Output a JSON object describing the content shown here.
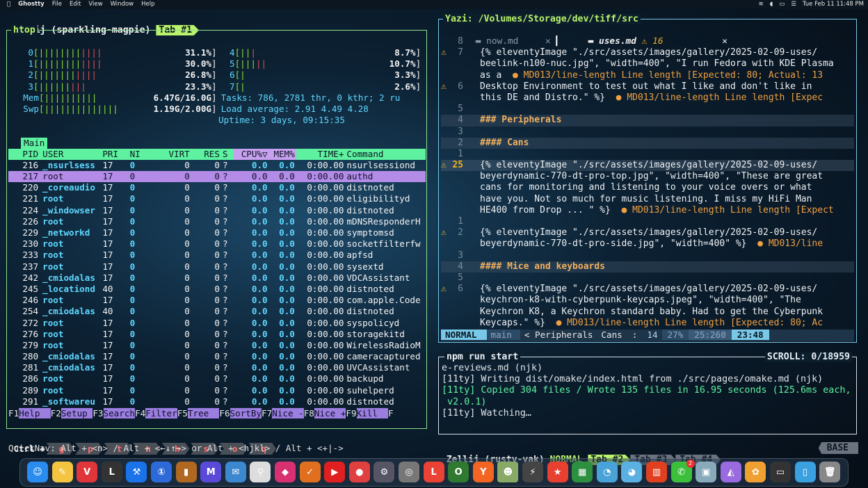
{
  "menubar": {
    "app": "Ghostty",
    "items": [
      "File",
      "Edit",
      "View",
      "Window",
      "Help"
    ],
    "clock": "Tue Feb 11  11:48 PM"
  },
  "zellij_top": {
    "session": "Zellij (sparkling-magpie)",
    "tab": "Tab #1"
  },
  "htop": {
    "title": "htop",
    "cpus_left": [
      {
        "n": "0",
        "pct": "31.1%"
      },
      {
        "n": "1",
        "pct": "30.0%"
      },
      {
        "n": "2",
        "pct": "26.8%"
      },
      {
        "n": "3",
        "pct": "23.3%"
      }
    ],
    "cpus_right": [
      {
        "n": "4",
        "pct": "8.7%"
      },
      {
        "n": "5",
        "pct": "10.7%"
      },
      {
        "n": "6",
        "pct": "3.3%"
      },
      {
        "n": "7",
        "pct": "2.6%"
      }
    ],
    "mem": "6.47G/16.0G",
    "swp": "1.19G/2.00G",
    "tasks": "Tasks: 786, 2781 thr, 0 kthr; 2 ru",
    "load": "Load average: 2.91 4.49 4.28",
    "uptime": "Uptime: 3 days, 09:15:35",
    "tab": "Main",
    "columns": [
      "PID",
      "USER",
      "PRI",
      "NI",
      "VIRT",
      "RES",
      "S",
      "CPU%▽",
      "MEM%",
      "TIME+",
      "Command"
    ],
    "procs": [
      [
        "216",
        "_nsurlsess",
        "17",
        "0",
        "0",
        "0",
        "?",
        "0.0",
        "0.0",
        "0:00.00",
        "nsurlsessiond"
      ],
      [
        "217",
        "root",
        "17",
        "0",
        "0",
        "0",
        "?",
        "0.0",
        "0.0",
        "0:00.00",
        "authd"
      ],
      [
        "220",
        "_coreaudio",
        "17",
        "0",
        "0",
        "0",
        "?",
        "0.0",
        "0.0",
        "0:00.00",
        "distnoted"
      ],
      [
        "221",
        "root",
        "17",
        "0",
        "0",
        "0",
        "?",
        "0.0",
        "0.0",
        "0:00.00",
        "eligibilityd"
      ],
      [
        "224",
        "_windowser",
        "17",
        "0",
        "0",
        "0",
        "?",
        "0.0",
        "0.0",
        "0:00.00",
        "distnoted"
      ],
      [
        "226",
        "root",
        "17",
        "0",
        "0",
        "0",
        "?",
        "0.0",
        "0.0",
        "0:00.00",
        "mDNSResponderH"
      ],
      [
        "229",
        "_networkd",
        "17",
        "0",
        "0",
        "0",
        "?",
        "0.0",
        "0.0",
        "0:00.00",
        "symptomsd"
      ],
      [
        "230",
        "root",
        "17",
        "0",
        "0",
        "0",
        "?",
        "0.0",
        "0.0",
        "0:00.00",
        "socketfilterfw"
      ],
      [
        "233",
        "root",
        "17",
        "0",
        "0",
        "0",
        "?",
        "0.0",
        "0.0",
        "0:00.00",
        "apfsd"
      ],
      [
        "237",
        "root",
        "17",
        "0",
        "0",
        "0",
        "?",
        "0.0",
        "0.0",
        "0:00.00",
        "sysextd"
      ],
      [
        "242",
        "_cmiodalas",
        "17",
        "0",
        "0",
        "0",
        "?",
        "0.0",
        "0.0",
        "0:00.00",
        "VDCAssistant"
      ],
      [
        "245",
        "_locationd",
        "40",
        "0",
        "0",
        "0",
        "?",
        "0.0",
        "0.0",
        "0:00.00",
        "distnoted"
      ],
      [
        "246",
        "root",
        "17",
        "0",
        "0",
        "0",
        "?",
        "0.0",
        "0.0",
        "0:00.00",
        "com.apple.Code"
      ],
      [
        "254",
        "_cmiodalas",
        "40",
        "0",
        "0",
        "0",
        "?",
        "0.0",
        "0.0",
        "0:00.00",
        "distnoted"
      ],
      [
        "272",
        "root",
        "17",
        "0",
        "0",
        "0",
        "?",
        "0.0",
        "0.0",
        "0:00.00",
        "syspolicyd"
      ],
      [
        "276",
        "root",
        "17",
        "0",
        "0",
        "0",
        "?",
        "0.0",
        "0.0",
        "0:00.00",
        "storagekitd"
      ],
      [
        "279",
        "root",
        "17",
        "0",
        "0",
        "0",
        "?",
        "0.0",
        "0.0",
        "0:00.00",
        "WirelessRadioM"
      ],
      [
        "280",
        "_cmiodalas",
        "17",
        "0",
        "0",
        "0",
        "?",
        "0.0",
        "0.0",
        "0:00.00",
        "cameracaptured"
      ],
      [
        "281",
        "_cmiodalas",
        "17",
        "0",
        "0",
        "0",
        "?",
        "0.0",
        "0.0",
        "0:00.00",
        "UVCAssistant"
      ],
      [
        "286",
        "root",
        "17",
        "0",
        "0",
        "0",
        "?",
        "0.0",
        "0.0",
        "0:00.00",
        "backupd"
      ],
      [
        "289",
        "root",
        "17",
        "0",
        "0",
        "0",
        "?",
        "0.0",
        "0.0",
        "0:00.00",
        "suhelperd"
      ],
      [
        "291",
        "_softwareu",
        "17",
        "0",
        "0",
        "0",
        "?",
        "0.0",
        "0.0",
        "0:00.00",
        "distnoted"
      ]
    ],
    "fkeys": [
      {
        "k": "F1",
        "v": "Help  "
      },
      {
        "k": "F2",
        "v": "Setup "
      },
      {
        "k": "F3",
        "v": "Search"
      },
      {
        "k": "F4",
        "v": "Filter"
      },
      {
        "k": "F5",
        "v": "Tree  "
      },
      {
        "k": "F6",
        "v": "SortBy"
      },
      {
        "k": "F7",
        "v": "Nice -"
      },
      {
        "k": "F8",
        "v": "Nice +"
      },
      {
        "k": "F9",
        "v": "Kill  "
      },
      {
        "k": "F",
        "v": ""
      }
    ]
  },
  "zellij_hints": {
    "ctrl": "Ctrl +",
    "keys": [
      "g",
      "p",
      "t",
      "n",
      "h",
      "s",
      "o",
      "q"
    ],
    "quicknav": "QuickNav: Alt + <n> / Alt + <←↓↑→> or Alt + <hjkl> / Alt + <+|->"
  },
  "editor": {
    "title": "Yazi: /Volumes/Storage/dev/tiff/src",
    "tab1": "now.md",
    "tab2": "uses.md",
    "warn_count": "16",
    "lines": [
      {
        "n": "8",
        "w": false,
        "t": "",
        "d": ""
      },
      {
        "n": "7",
        "w": true,
        "t": "{% eleventyImage \"./src/assets/images/gallery/2025-02-09-uses/",
        "d": ""
      },
      {
        "n": "",
        "w": false,
        "t": "beelink-n100-nuc.jpg\", \"width=400\", \"I run Fedora with KDE Plasma",
        "d": ""
      },
      {
        "n": "",
        "w": false,
        "t": "as a",
        "d": "  ● MD013/line-length Line length [Expected: 80; Actual: 13"
      },
      {
        "n": "6",
        "w": true,
        "t": "Desktop Environment to test out what I like and don't like in",
        "d": ""
      },
      {
        "n": "",
        "w": false,
        "t": "this DE and Distro.\" %}",
        "d": "  ● MD013/line-length Line length [Expec"
      },
      {
        "n": "5",
        "w": false,
        "t": "",
        "d": ""
      },
      {
        "n": "4",
        "w": false,
        "t": "### Peripherals",
        "d": "",
        "h": true
      },
      {
        "n": "3",
        "w": false,
        "t": "",
        "d": ""
      },
      {
        "n": "2",
        "w": false,
        "t": "#### Cans",
        "d": "",
        "h": true
      },
      {
        "n": "1",
        "w": false,
        "t": "",
        "d": ""
      },
      {
        "n": "25",
        "w": true,
        "cur": true,
        "t": "{% eleventyImage \"./src/assets/images/gallery/2025-02-09-uses/",
        "d": ""
      },
      {
        "n": "",
        "w": false,
        "t": "beyerdynamic-770-dt-pro-top.jpg\", \"width=400\", \"These are great",
        "d": ""
      },
      {
        "n": "",
        "w": false,
        "t": "cans for monitoring and listening to your voice overs or what",
        "d": ""
      },
      {
        "n": "",
        "w": false,
        "t": "have you. Not so much for music listening. I miss my HiFi Man",
        "d": ""
      },
      {
        "n": "",
        "w": false,
        "t": "HE400 from Drop ... \" %}",
        "d": "  ● MD013/line-length Line length [Expect"
      },
      {
        "n": "1",
        "w": false,
        "t": "",
        "d": ""
      },
      {
        "n": "2",
        "w": true,
        "t": "{% eleventyImage \"./src/assets/images/gallery/2025-02-09-uses/",
        "d": ""
      },
      {
        "n": "",
        "w": false,
        "t": "beyerdynamic-770-dt-pro-side.jpg\", \"width=400\" %}",
        "d": "  ● MD013/line"
      },
      {
        "n": "3",
        "w": false,
        "t": "",
        "d": ""
      },
      {
        "n": "4",
        "w": false,
        "t": "#### Mice and keyboards",
        "d": "",
        "h": true
      },
      {
        "n": "5",
        "w": false,
        "t": "",
        "d": ""
      },
      {
        "n": "6",
        "w": true,
        "t": "{% eleventyImage \"./src/assets/images/gallery/2025-02-09-uses/",
        "d": ""
      },
      {
        "n": "",
        "w": false,
        "t": "keychron-k8-with-cyberpunk-keycaps.jpeg\", \"width=400\", \"The",
        "d": ""
      },
      {
        "n": "",
        "w": false,
        "t": "Keychron K8, a Keychron standard baby. Had to get the Cyberpunk",
        "d": ""
      },
      {
        "n": "",
        "w": false,
        "t": "Keycaps.\" %}",
        "d": "  ● MD013/line-length Line length [Expected: 80; Ac"
      }
    ],
    "status": {
      "mode": "NORMAL",
      "branch": "main",
      "crumb": "< Peripherals",
      "sub": "Cans",
      "sep": ":",
      "diag": "14",
      "pct": "27%",
      "pos": "25:260",
      "time": "23:48"
    }
  },
  "npm": {
    "title": "npm run start",
    "scroll": "SCROLL:  0/18959",
    "lines": [
      {
        "t": "e-reviews.md (njk)",
        "c": ""
      },
      {
        "t": "[11ty] Writing dist/omake/index.html from ./src/pages/omake.md (njk)",
        "c": ""
      },
      {
        "t": "[11ty] Copied 304 files / Wrote 135 files in 16.95 seconds (125.6ms each,",
        "c": "g"
      },
      {
        "t": " v2.0.1)",
        "c": "g"
      },
      {
        "t": "[11ty] Watching…",
        "c": ""
      }
    ]
  },
  "zellij_bottom": {
    "session": "Zellij (rusty-yak)",
    "mode": "NORMAL",
    "tabs": [
      "Tab #2",
      "Tab #3",
      "Tab #4"
    ],
    "base": "BASE"
  },
  "dock": {
    "items": [
      "finder-icon",
      "notes-icon",
      "vivaldi-icon",
      "lmstudio-icon",
      "xcode-icon",
      "1password-icon",
      "books-icon",
      "mastodon-icon",
      "mimestream-icon",
      "spotlight-icon",
      "affinity-icon",
      "feeder-icon",
      "youtube-icon",
      "pocketcasts-icon",
      "altserver-icon",
      "findmy-icon",
      "linear-icon",
      "office-icon",
      "yc-icon",
      "avatar-icon",
      "hammerspoon-icon",
      "reeder-icon",
      "sheets-icon",
      "gopher-icon",
      "gopher2-icon",
      "presentation-icon",
      "messages-icon",
      "preview-icon",
      "affinity2-icon",
      "photos-icon",
      "terminal-icon",
      "folder-icon",
      "trash-icon"
    ],
    "messages_badge": "2"
  }
}
